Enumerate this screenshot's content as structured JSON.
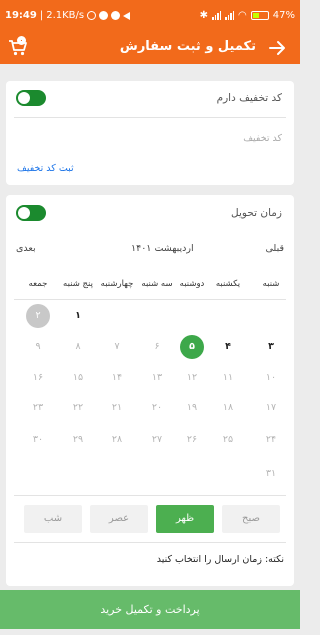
{
  "status_bar": {
    "time": "19:49",
    "speed": "2.1KB/s",
    "battery": "47",
    "battery_percent": 47
  },
  "header": {
    "title": "تکمیل و ثبت سفارش",
    "cart_badge": "۰"
  },
  "discount": {
    "title": "کد تخفیف دارم",
    "toggle_on": true,
    "input_placeholder": "کد تخفیف",
    "submit_link": "ثبت کد تخفیف"
  },
  "delivery": {
    "title": "زمان تحویل",
    "toggle_on": true,
    "prev_label": "قبلی",
    "month_label": "اردیبهشت ۱۴۰۱",
    "next_label": "بعدی",
    "weekdays": [
      "شنبه",
      "یکشنبه",
      "دوشنبه",
      "سه شنبه",
      "چهارشنبه",
      "پنج شنبه",
      "جمعه"
    ],
    "days": [
      [
        "",
        "",
        "",
        "",
        "",
        "۱",
        "۲"
      ],
      [
        "۳",
        "۴",
        "۵",
        "۶",
        "۷",
        "۸",
        "۹"
      ],
      [
        "۱۰",
        "۱۱",
        "۱۲",
        "۱۳",
        "۱۴",
        "۱۵",
        "۱۶"
      ],
      [
        "۱۷",
        "۱۸",
        "۱۹",
        "۲۰",
        "۲۱",
        "۲۲",
        "۲۳"
      ],
      [
        "۲۴",
        "۲۵",
        "۲۶",
        "۲۷",
        "۲۸",
        "۲۹",
        "۳۰"
      ],
      [
        "۳۱",
        "",
        "",
        "",
        "",
        "",
        ""
      ]
    ],
    "selected_day": "۵",
    "bold_days": [
      "۱",
      "۳",
      "۴"
    ],
    "grey_day": "۲",
    "time_slots": [
      {
        "label": "صبح",
        "active": false
      },
      {
        "label": "ظهر",
        "active": true
      },
      {
        "label": "عصر",
        "active": false
      },
      {
        "label": "شب",
        "active": false
      }
    ],
    "note": "نکته: زمان ارسال را انتخاب کنید"
  },
  "footer": {
    "pay_label": "پرداخت و تکمیل خرید"
  },
  "colors": {
    "primary": "#f26a1b",
    "toggle": "#1b8a2e",
    "selected": "#3da84a",
    "active_slot": "#4caf50",
    "pay_button": "#66bb6a",
    "link": "#1a73e8"
  }
}
